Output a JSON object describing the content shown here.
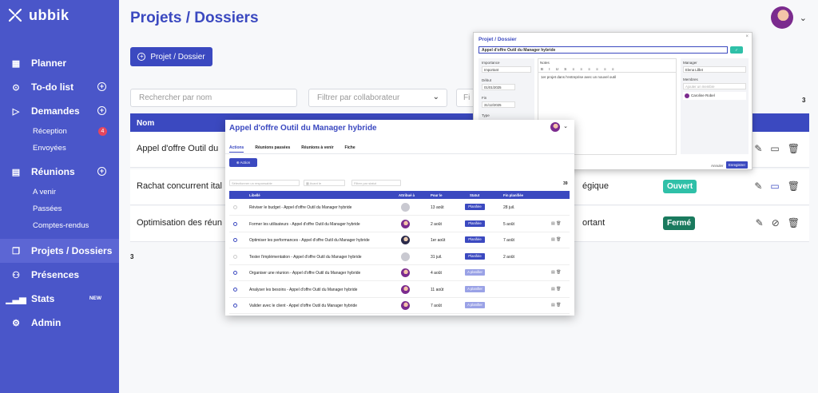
{
  "app": {
    "logo_text": "ubbik"
  },
  "sidebar": {
    "items": [
      {
        "label": "Planner",
        "icon": "calendar-icon"
      },
      {
        "label": "To-do list",
        "icon": "check-circle-icon"
      },
      {
        "label": "Demandes",
        "icon": "play-icon"
      },
      {
        "label": "Réception",
        "badge": "4"
      },
      {
        "label": "Envoyées"
      },
      {
        "label": "Réunions",
        "icon": "meeting-icon"
      },
      {
        "label": "A venir"
      },
      {
        "label": "Passées"
      },
      {
        "label": "Comptes-rendus"
      },
      {
        "label": "Projets / Dossiers",
        "icon": "folders-icon"
      },
      {
        "label": "Présences",
        "icon": "people-icon"
      },
      {
        "label": "Stats",
        "icon": "stats-icon",
        "tag": "NEW"
      },
      {
        "label": "Admin",
        "icon": "gear-icon"
      }
    ]
  },
  "main": {
    "title": "Projets / Dossiers",
    "add_button": "Projet / Dossier",
    "search_placeholder": "Rechercher par nom",
    "filter_placeholder": "Filtrer par collaborateur",
    "filter2_placeholder": "Fi",
    "count_top": "3",
    "count_bottom": "3",
    "column_name": "Nom",
    "rows": [
      {
        "name": "Appel d'offre Outil du",
        "label": "",
        "status": "",
        "status_color": ""
      },
      {
        "name": "Rachat concurrent ital",
        "label": "égique",
        "status": "Ouvert",
        "status_color": "#2fc0a8"
      },
      {
        "name": "Optimisation des réun",
        "label": "ortant",
        "status": "Fermé",
        "status_color": "#1a7a5e"
      }
    ]
  },
  "modal_back": {
    "title": "Projet / Dossier",
    "name_value": "Appel d'offre Outil du Manager hybride",
    "importance_label": "Importance",
    "importance_value": "Important",
    "debut_label": "Début",
    "debut_value": "01/01/2025",
    "fin_label": "Fin",
    "fin_value": "31/12/2025",
    "type_label": "Type",
    "notes_label": "Notes",
    "toolbar": "B I U S ≡ ≡ ≡ ≡ ≡ ≡",
    "notes_text": "1er projet dans l'entreprise avec un nouvel outil",
    "manager_label": "Manager",
    "manager_value": "Elena Lilllet",
    "membres_label": "Membres",
    "membres_placeholder": "Ajouter un membre",
    "person_name": "Caroline Robel",
    "cancel": "Annuler",
    "save": "Enregistrer"
  },
  "modal_front": {
    "title": "Appel d'offre Outil du Manager hybride",
    "tabs": [
      "Actions",
      "Réunions passées",
      "Réunions à venir",
      "Fiche"
    ],
    "action_button": "Action",
    "filter_person": "Sélectionner un responsable",
    "filter_date": "Avant le",
    "filter_status": "Filtrer par statut",
    "count": "39",
    "columns": [
      "Libellé",
      "Attribué à",
      "Pour le",
      "Statut",
      "Fin planifiée"
    ],
    "rows": [
      {
        "label": "Réviser le budget - Appel d'offre Outil du Manager hybride",
        "due": "13 août",
        "status": "Planifiée",
        "end": "28 juil.",
        "done": true
      },
      {
        "label": "Former les utilisateurs - Appel d'offre Outil du Manager hybride",
        "due": "2 août",
        "status": "Planifiée",
        "end": "5 août",
        "done": false
      },
      {
        "label": "Optimiser les performances - Appel d'offre Outil du Manager hybride",
        "due": "1er août",
        "status": "Planifiée",
        "end": "7 août",
        "done": false
      },
      {
        "label": "Tester l'implémentation - Appel d'offre Outil du Manager hybride",
        "due": "31 juil.",
        "status": "Planifiée",
        "end": "2 août",
        "done": true
      },
      {
        "label": "Organiser une réunion - Appel d'offre Outil du Manager hybride",
        "due": "4 août",
        "status": "A planifier",
        "end": "",
        "done": false
      },
      {
        "label": "Analyser les besoins - Appel d'offre Outil du Manager hybride",
        "due": "11 août",
        "status": "A planifier",
        "end": "",
        "done": false
      },
      {
        "label": "Valider avec le client - Appel d'offre Outil du Manager hybride",
        "due": "7 août",
        "status": "A planifier",
        "end": "",
        "done": false
      }
    ]
  },
  "colors": {
    "primary": "#3b49c0",
    "sidebar": "#4a56c9",
    "open": "#2fc0a8",
    "closed": "#1a7a5e",
    "planned": "#3b49c0",
    "to_plan": "#9aa2e6"
  }
}
